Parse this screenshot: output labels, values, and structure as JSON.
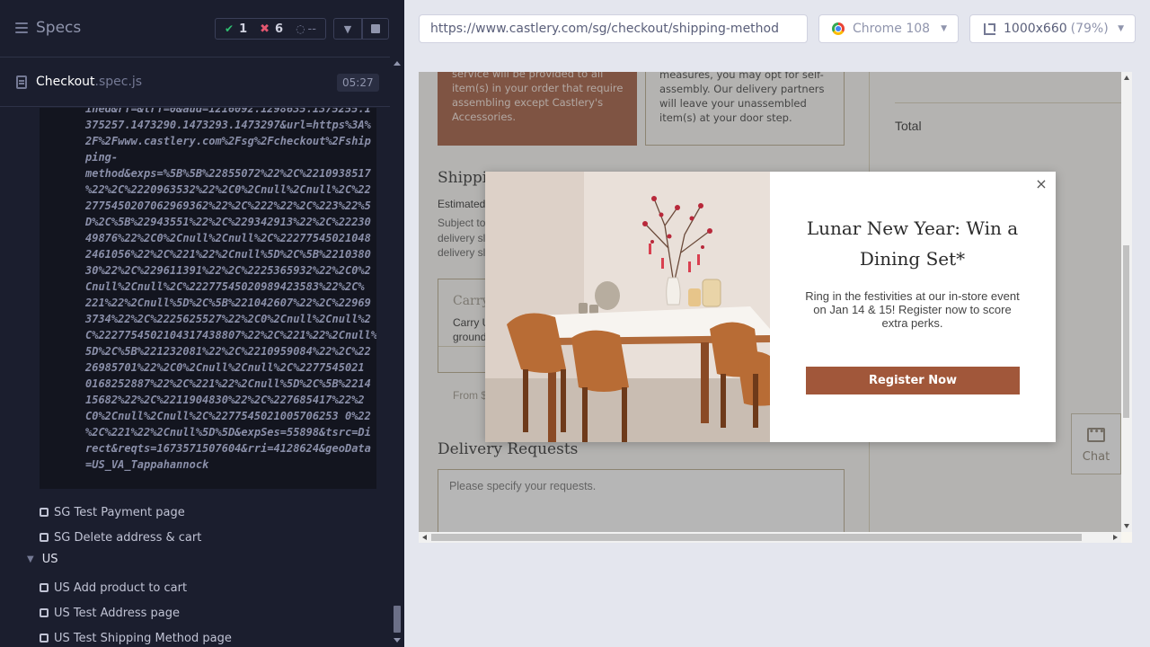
{
  "runner": {
    "title": "Specs",
    "stats": {
      "passed": "1",
      "failed": "6",
      "pending": "--"
    },
    "spec": {
      "name": "Checkout",
      "ext": ".spec.js",
      "duration": "05:27"
    },
    "log_lines": [
      "ined&rf=&trf=0&aud=1216092.1298635.1375255.1",
      "375257.1473290.1473293.1473297&url=https%3A%",
      "2F%2Fwww.castlery.com%2Fsg%2Fcheckout%2Fship",
      "ping-",
      "method&exps=%5B%5B%22855072%22%2C%2210938517",
      "%22%2C%2220963532%22%2C0%2Cnull%2Cnull%2C%22",
      "2775450207062969362%22%2C%222%22%2C%223%22%5",
      "D%2C%5B%22943551%22%2C%229342913%22%2C%22230",
      "49876%22%2C0%2Cnull%2Cnull%2C%22277545021048",
      "2461056%22%2C%221%22%2Cnull%5D%2C%5B%2210380",
      "30%22%2C%229611391%22%2C%2225365932%22%2C0%2",
      "Cnull%2Cnull%2C%22277545020989423583%22%2C%",
      "221%22%2Cnull%5D%2C%5B%221042607%22%2C%22969",
      "3734%22%2C%2225625527%22%2C0%2Cnull%2Cnull%2",
      "C%2227754502104317438807%22%2C%221%22%2Cnull%",
      "5D%2C%5B%221232081%22%2C%2210959084%22%2C%22",
      "26985701%22%2C0%2Cnull%2Cnull%2C%2277545021",
      "0168252887%22%2C%221%22%2Cnull%5D%2C%5B%2214",
      "15682%22%2C%2211904830%22%2C%227685417%22%2",
      "C0%2Cnull%2Cnull%2C%2277545021005706253 0%22",
      "%2C%221%22%2Cnull%5D%5D&expSes=55898&tsrc=Di",
      "rect&reqts=1673571507604&rri=4128624&geoData",
      "=US_VA_Tappahannock"
    ],
    "tests": [
      "SG Test Payment page",
      "SG Delete address & cart",
      "US Add product to cart",
      "US Test Address page",
      "US Test Shipping Method page"
    ],
    "suite_us": "US"
  },
  "aut_header": {
    "url": "https://www.castlery.com/sg/checkout/shipping-method",
    "browser": "Chrome 108",
    "viewport": "1000x660",
    "viewport_pct": "(79%)"
  },
  "page": {
    "card_brown_text": "service will be provided to all item(s) in your order that require assembling except Castlery's Accessories.",
    "card_outline_text": "measures, you may opt for self-assembly. Our delivery partners will leave your unassembled item(s) at your door step.",
    "total_label": "Total",
    "shipping_heading": "Shippin",
    "estimated": "Estimated",
    "subject_text": "Subject to delivery sl delivery sl",
    "carry_title": "Carry",
    "carry_desc": "Carry U ground",
    "carry_price": "From $",
    "delivery_heading": "Delivery Requests",
    "delivery_placeholder": "Please specify your requests.",
    "chat_label": "Chat"
  },
  "popup": {
    "title": "Lunar New Year: Win a Dining Set*",
    "body": "Ring in the festivities at our in-store event on Jan 14 & 15! Register now to score extra perks.",
    "cta": "Register Now",
    "close": "×"
  },
  "colors": {
    "accent": "#a1573a",
    "pass": "#2fbf71",
    "fail": "#e45770"
  }
}
